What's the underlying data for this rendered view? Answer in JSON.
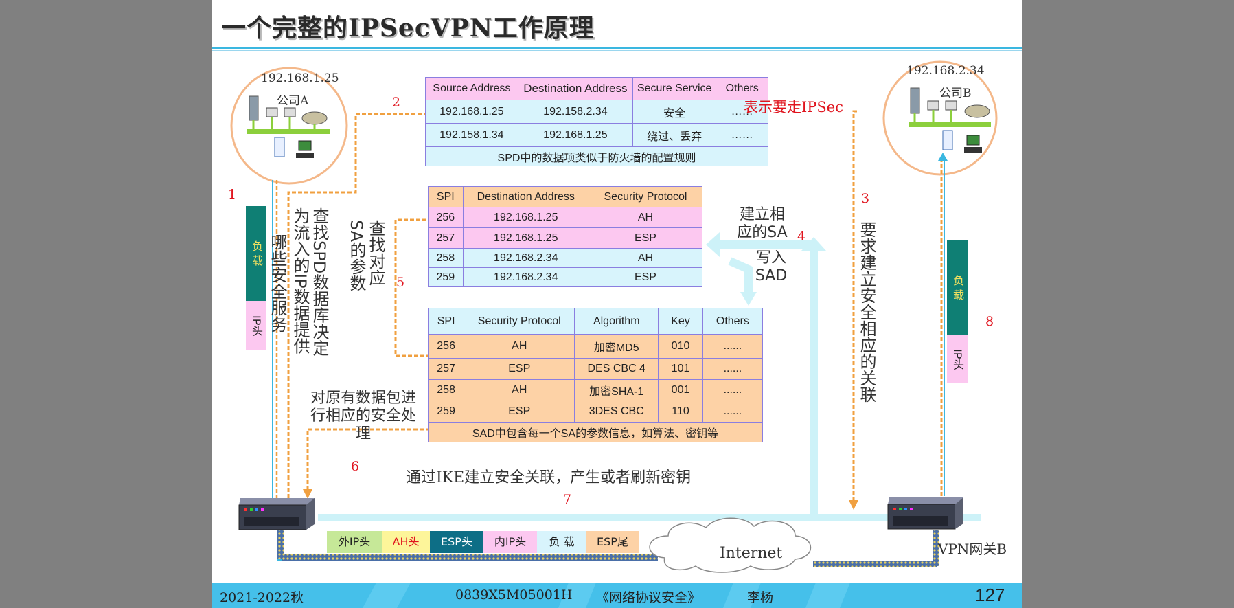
{
  "title": "一个完整的IPSecVPN工作原理",
  "company_a": {
    "ip": "192.168.1.25",
    "name": "公司A"
  },
  "company_b": {
    "ip": "192.168.2.34",
    "name": "公司B"
  },
  "steps": {
    "s1": "1",
    "s2": "2",
    "s3": "3",
    "s4": "4",
    "s5": "5",
    "s6": "6",
    "s7": "7",
    "s8": "8"
  },
  "spd_table": {
    "headers": [
      "Source Address",
      "Destination Address",
      "Secure Service",
      "Others"
    ],
    "rows": [
      [
        "192.168.1.25",
        "192.158.2.34",
        "安全",
        "……"
      ],
      [
        "192.158.1.34",
        "192.168.1.25",
        "绕过、丢弃",
        "……"
      ]
    ],
    "footer": "SPD中的数据项类似于防火墙的配置规则",
    "annotation": "表示要走IPSec"
  },
  "sa_table": {
    "headers": [
      "SPI",
      "Destination Address",
      "Security Protocol"
    ],
    "rows": [
      [
        "256",
        "192.168.1.25",
        "AH"
      ],
      [
        "257",
        "192.168.1.25",
        "ESP"
      ],
      [
        "258",
        "192.168.2.34",
        "AH"
      ],
      [
        "259",
        "192.168.2.34",
        "ESP"
      ]
    ]
  },
  "sad_table": {
    "headers": [
      "SPI",
      "Security Protocol",
      "Algorithm",
      "Key",
      "Others"
    ],
    "rows": [
      [
        "256",
        "AH",
        "加密MD5",
        "010",
        "......"
      ],
      [
        "257",
        "ESP",
        "DES CBC 4",
        "101",
        "......"
      ],
      [
        "258",
        "AH",
        "加密SHA-1",
        "001",
        "......"
      ],
      [
        "259",
        "ESP",
        "3DES CBC",
        "110",
        "......"
      ]
    ],
    "footer": "SAD中包含每一个SA的参数信息，如算法、密钥等"
  },
  "notes": {
    "which_service": "哪些安全服务",
    "lookup_spd": "查找SPD数据库决定为流入的IP数据提供",
    "lookup_sa": "查找对应SA的参数",
    "build_sa": "建立相应的SA",
    "write_sad": "写入SAD",
    "request_sa": "要求建立安全相应的关联",
    "process_packet": "对原有数据包进行相应的安全处理",
    "ike": "通过IKE建立安全关联，产生或者刷新密钥",
    "internet": "Internet",
    "gateway_b": "VPN网关B"
  },
  "payload_block": {
    "top": "负 载",
    "bottom": "IP头"
  },
  "packet": {
    "fields": [
      {
        "label": "外IP头",
        "bg": "#c6e898",
        "color": "#222222"
      },
      {
        "label": "AH头",
        "bg": "#fdf59a",
        "color": "#e0141e"
      },
      {
        "label": "ESP头",
        "bg": "#0d6e86",
        "color": "#ffffff"
      },
      {
        "label": "内IP头",
        "bg": "#fcc8f0",
        "color": "#222222"
      },
      {
        "label": "负 载",
        "bg": "#d8f4fc",
        "color": "#222222"
      },
      {
        "label": "ESP尾",
        "bg": "#fdd2a6",
        "color": "#222222"
      }
    ]
  },
  "footer": {
    "term": "2021-2022秋",
    "code": "0839X5M05001H",
    "course": "《网络协议安全》",
    "teacher": "李杨",
    "page": "127"
  },
  "colors": {
    "header_rule": "#3ab7e0",
    "footer_bg": "#45c0ea",
    "arrow_orange": "#f0a040",
    "arrow_light": "#cdf2f8"
  }
}
